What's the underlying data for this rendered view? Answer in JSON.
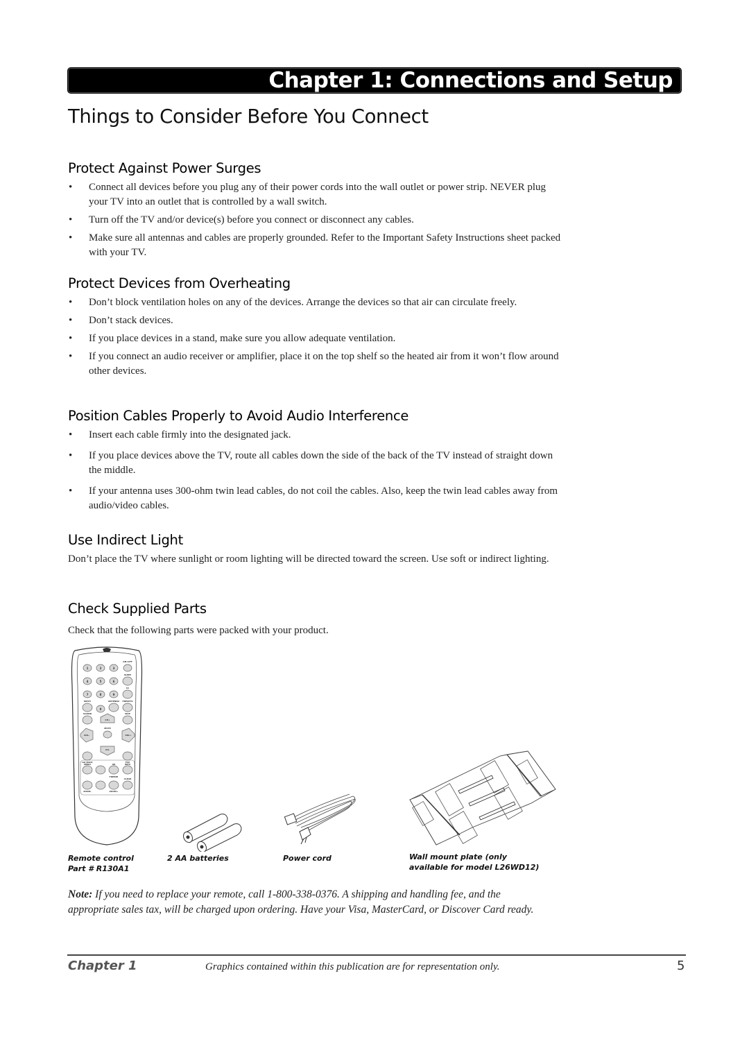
{
  "header": {
    "chapter_banner": "Chapter 1: Connections and Setup",
    "page_title": "Things to Consider Before You Connect"
  },
  "sections": {
    "surges": {
      "heading": "Protect Against Power Surges",
      "bullets": [
        "Connect all devices before you plug any of their power cords into the wall outlet or power strip. NEVER plug your TV into an outlet that is controlled by a wall switch.",
        "Turn off the TV and/or device(s) before you connect or disconnect any cables.",
        "Make sure all antennas and cables are properly grounded. Refer to the Important Safety Instructions sheet packed with your TV."
      ]
    },
    "overheating": {
      "heading": "Protect Devices from Overheating",
      "bullets": [
        "Don’t block ventilation holes on any of the devices. Arrange the devices so that air can circulate freely.",
        "Don’t stack devices.",
        "If you place devices in a stand, make sure you allow adequate ventilation.",
        "If you connect an audio receiver or amplifier, place it on the top shelf so the heated air from it won’t flow around other devices."
      ]
    },
    "cables": {
      "heading": "Position Cables Properly to Avoid Audio Interference",
      "bullets": [
        "Insert each cable firmly into the designated jack.",
        "If you place devices above the TV, route all cables down the side of the back of the TV instead of straight down the middle.",
        "If your antenna uses 300-ohm twin lead cables, do not coil the cables. Also, keep the twin lead cables away from audio/video cables."
      ]
    },
    "light": {
      "heading": "Use Indirect Light",
      "body": "Don’t place the TV where sunlight or room lighting will be directed toward the screen. Use soft or indirect lighting."
    },
    "parts": {
      "heading": "Check Supplied Parts",
      "body": "Check that the following parts were packed with your product."
    }
  },
  "bullet_glyph": "•",
  "parts": {
    "remote": {
      "caption_line1": "Remote control",
      "caption_line2": "Part # R130A1",
      "buttons": {
        "on_off": "ON•OFF",
        "sleep": "SLEEP",
        "cc": "CC",
        "input": "INPUT",
        "antenna": "ANTENNA",
        "presets": "PRESETS",
        "sound": "SOUND",
        "skip": "SKIP",
        "ch_up": "CH+",
        "ch_down": "CH-",
        "vol_down": "VOL-",
        "vol_up": "VOL+",
        "mute": "MUTE",
        "go_back": "GO BACK",
        "fav": "FAV",
        "menu": "MENU",
        "ok": "OK",
        "info": "INFO",
        "freeze": "FREEZE",
        "clear": "CLEAR",
        "zoom_down": "ZOOM-",
        "zoom_up": "ZOOM+",
        "digits": [
          "1",
          "2",
          "3",
          "4",
          "5",
          "6",
          "7",
          "8",
          "9",
          "0"
        ]
      }
    },
    "batteries": {
      "caption": "2 AA batteries"
    },
    "power_cord": {
      "caption": "Power cord"
    },
    "wall_mount": {
      "caption_line1": "Wall mount plate (only",
      "caption_line2": "available for model L26WD12)"
    }
  },
  "note": {
    "label": "Note:",
    "text": " If you need to replace your remote, call 1-800-338-0376. A shipping and handling fee, and the appropriate sales tax, will be charged upon ordering. Have your Visa, MasterCard, or Discover Card ready."
  },
  "footer": {
    "chapter": "Chapter 1",
    "disclaimer": "Graphics contained within this publication are for representation only.",
    "page_number": "5"
  }
}
